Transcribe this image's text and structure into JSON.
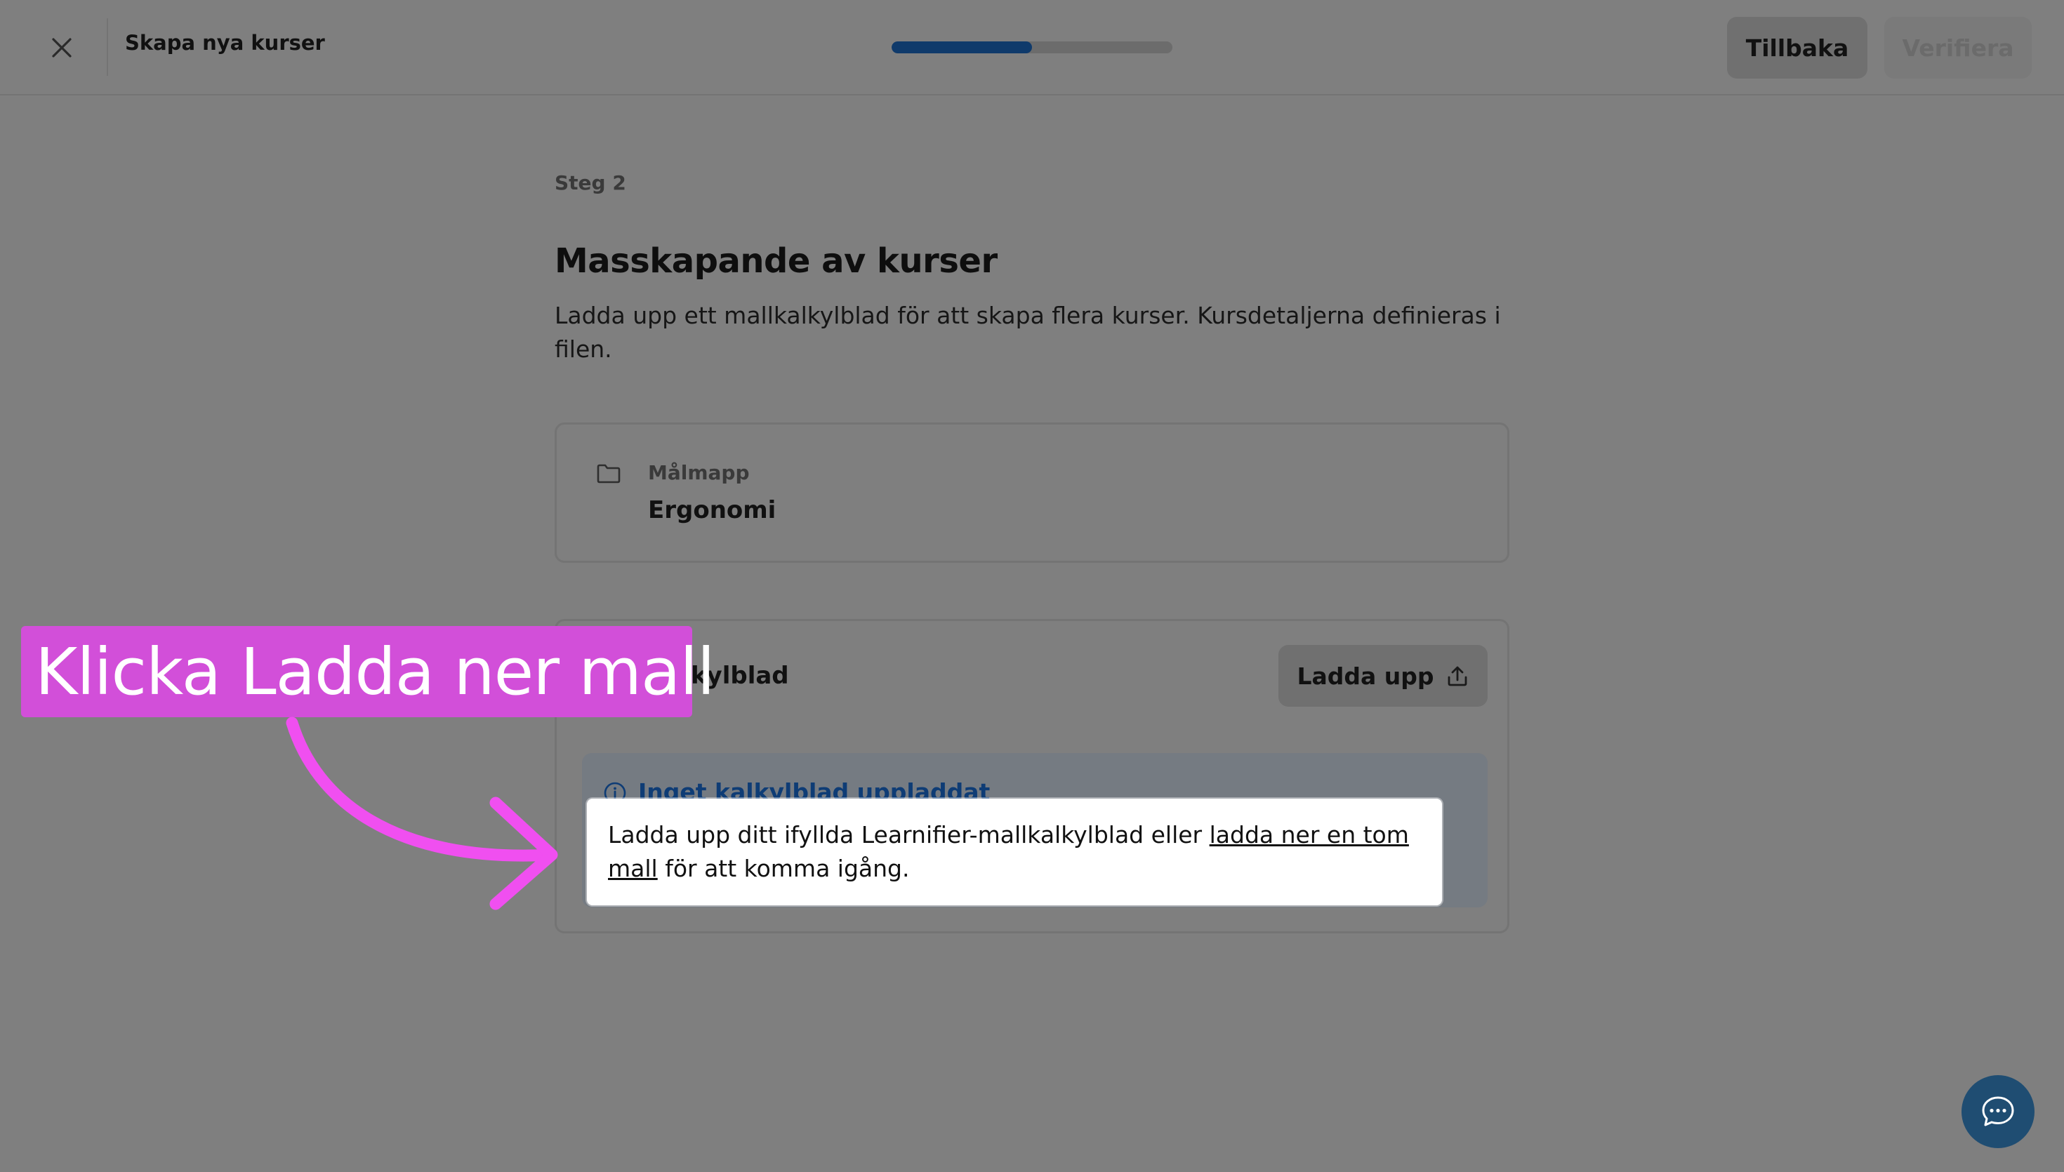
{
  "header": {
    "title": "Skapa nya kurser",
    "progress": 0.5,
    "back_label": "Tillbaka",
    "verify_label": "Verifiera"
  },
  "main": {
    "step": "Steg 2",
    "title": "Masskapande av kurser",
    "description": "Ladda upp ett mallkalkylblad för att skapa flera kurser. Kursdetaljerna definieras i filen.",
    "folder": {
      "label": "Målmapp",
      "value": "Ergonomi"
    },
    "spreadsheet": {
      "label": "Kalkylblad",
      "upload_label": "Ladda upp",
      "info_title": "Inget kalkylblad uppladdat",
      "info_text_before": "Ladda upp ditt ifyllda Learnifier-mallkalkylblad eller ",
      "info_link": "ladda ner en tom mall",
      "info_text_after": " för att komma igång."
    }
  },
  "callout": {
    "text": "Klicka Ladda ner mall"
  },
  "colors": {
    "overlay_gray": "#7f7f7f",
    "progress_fill": "#0f3a6b",
    "info_title": "#0e3c75",
    "callout_bg": "#d24fd9",
    "arrow": "#f04ff0",
    "chat_bg": "#1f4d72"
  },
  "icons": {
    "close": "close-icon",
    "folder": "folder-icon",
    "spreadsheet": "spreadsheet-icon",
    "upload": "upload-icon",
    "info": "info-icon",
    "chat": "chat-icon"
  }
}
